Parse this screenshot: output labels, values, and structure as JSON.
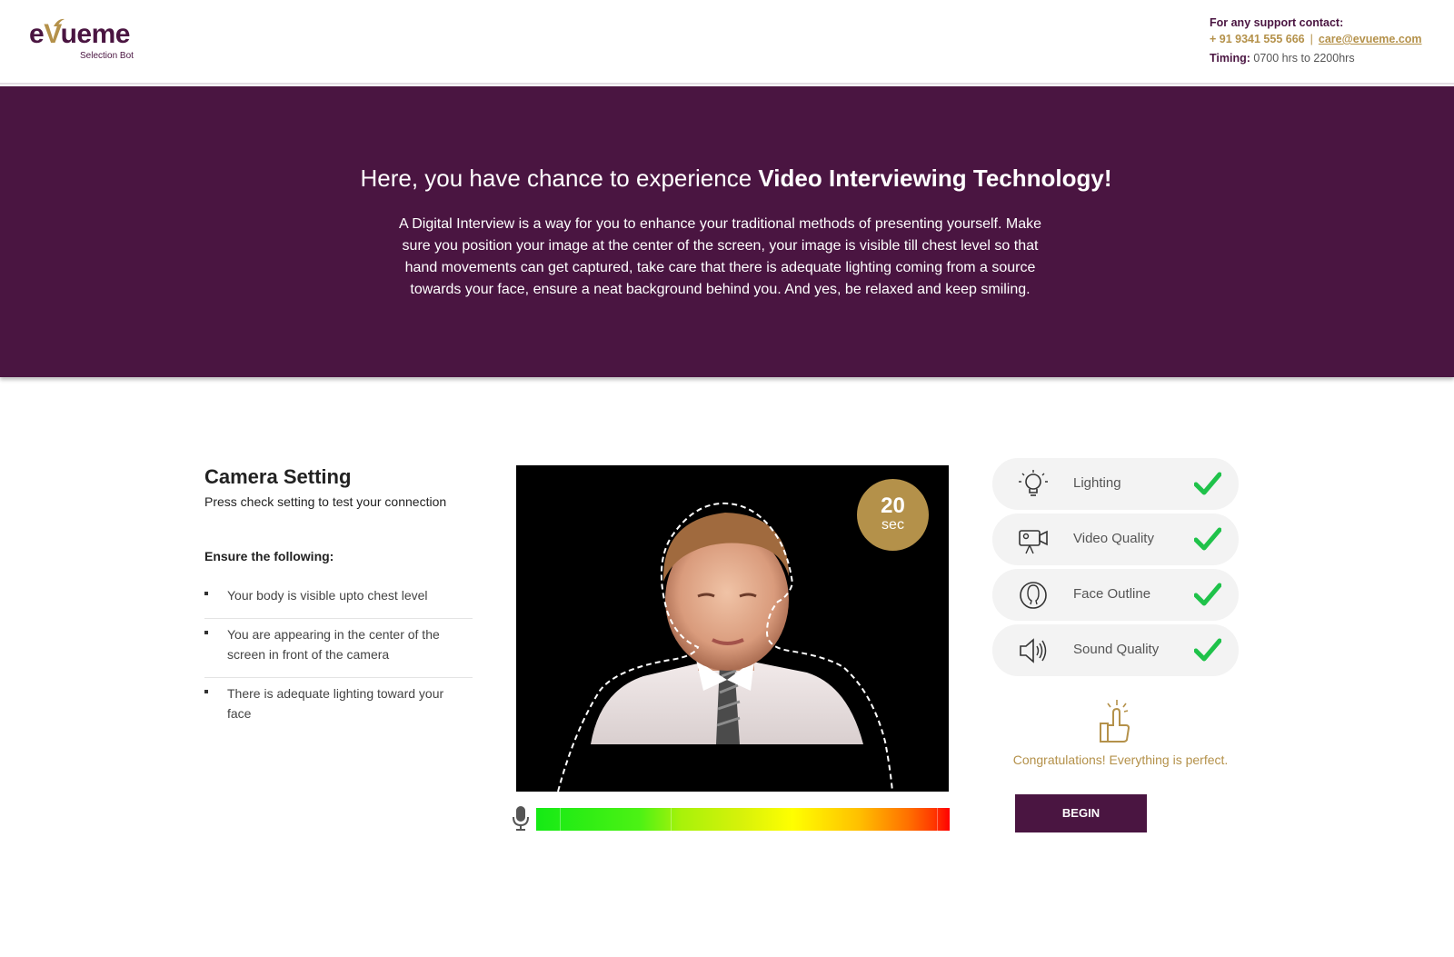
{
  "header": {
    "logo": {
      "word_pre": "e",
      "word_v": "V",
      "word_post": "ueme",
      "tagline": "Selection Bot"
    },
    "support": {
      "label": "For any support contact:",
      "phone": "+ 91 9341 555 666",
      "separator": "|",
      "email": "care@evueme.com",
      "timing_label": "Timing:",
      "timing_value": "0700 hrs to  2200hrs"
    }
  },
  "hero": {
    "title_light": "Here, you have chance to experience",
    "title_bold": "Video Interviewing Technology!",
    "description": "A Digital Interview is a way for you to enhance your traditional methods of presenting yourself. Make sure you position your image at the center of the screen, your image is visible till chest level so that hand movements can get captured, take care that there is adequate lighting coming from a source towards your face, ensure a neat background behind you. And yes, be relaxed and keep smiling."
  },
  "camera_setting": {
    "title": "Camera Setting",
    "subtitle": "Press check setting to test your connection",
    "ensure_label": "Ensure the following:",
    "items": [
      "Your body is visible upto chest level",
      "You are appearing in the center of the screen in front of the camera",
      "There is adequate lighting toward your face"
    ]
  },
  "video": {
    "timer_value": "20",
    "timer_unit": "sec",
    "audio_level": 1.0
  },
  "checks": [
    {
      "label": "Lighting",
      "icon": "bulb-icon",
      "status": "ok"
    },
    {
      "label": "Video Quality",
      "icon": "video-camera-icon",
      "status": "ok"
    },
    {
      "label": "Face Outline",
      "icon": "face-outline-icon",
      "status": "ok"
    },
    {
      "label": "Sound Quality",
      "icon": "speaker-icon",
      "status": "ok"
    }
  ],
  "result": {
    "message": "Congratulations! Everything is perfect.",
    "begin_label": "BEGIN"
  },
  "colors": {
    "brand_purple": "#4a1541",
    "brand_gold": "#b4914a",
    "check_green": "#1fc24a"
  }
}
